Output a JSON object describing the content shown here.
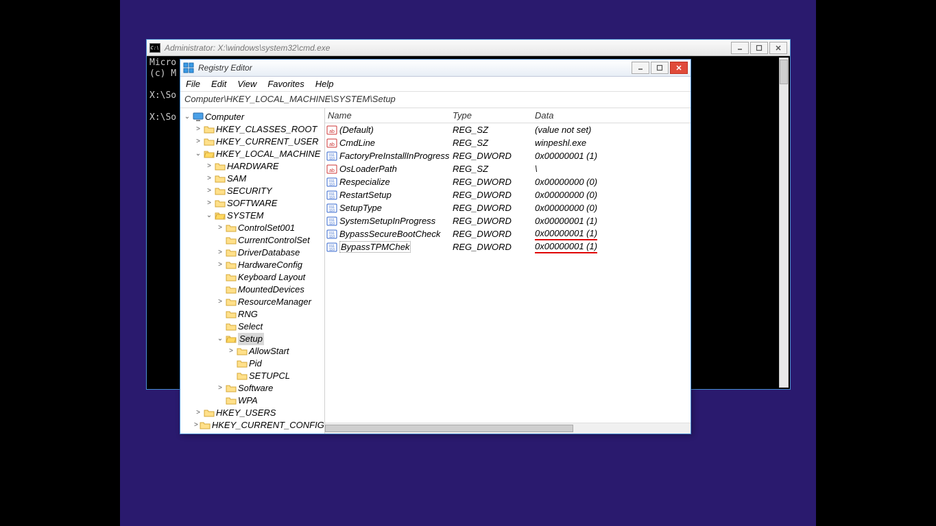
{
  "cmd": {
    "title": "Administrator: X:\\windows\\system32\\cmd.exe",
    "lines": [
      "Micro",
      "(c) M",
      "",
      "X:\\So",
      "",
      "X:\\So"
    ]
  },
  "reg": {
    "title": "Registry Editor",
    "menu": [
      "File",
      "Edit",
      "View",
      "Favorites",
      "Help"
    ],
    "address": "Computer\\HKEY_LOCAL_MACHINE\\SYSTEM\\Setup",
    "cols": {
      "name": "Name",
      "type": "Type",
      "data": "Data"
    },
    "tree": {
      "root": "Computer",
      "hkeys": {
        "classes": "HKEY_CLASSES_ROOT",
        "cuser": "HKEY_CURRENT_USER",
        "lm": "HKEY_LOCAL_MACHINE",
        "users": "HKEY_USERS",
        "cconf": "HKEY_CURRENT_CONFIG"
      },
      "lm_children": [
        "HARDWARE",
        "SAM",
        "SECURITY",
        "SOFTWARE",
        "SYSTEM"
      ],
      "system_children": [
        "ControlSet001",
        "CurrentControlSet",
        "DriverDatabase",
        "HardwareConfig",
        "Keyboard Layout",
        "MountedDevices",
        "ResourceManager",
        "RNG",
        "Select",
        "Setup",
        "Software",
        "WPA"
      ],
      "setup_children": [
        "AllowStart",
        "Pid",
        "SETUPCL"
      ]
    },
    "values": [
      {
        "icon": "sz",
        "name": "(Default)",
        "type": "REG_SZ",
        "data": "(value not set)",
        "u": false
      },
      {
        "icon": "sz",
        "name": "CmdLine",
        "type": "REG_SZ",
        "data": "winpeshl.exe",
        "u": false
      },
      {
        "icon": "dw",
        "name": "FactoryPreInstallInProgress",
        "type": "REG_DWORD",
        "data": "0x00000001 (1)",
        "u": false
      },
      {
        "icon": "sz",
        "name": "OsLoaderPath",
        "type": "REG_SZ",
        "data": "\\",
        "u": false
      },
      {
        "icon": "dw",
        "name": "Respecialize",
        "type": "REG_DWORD",
        "data": "0x00000000 (0)",
        "u": false
      },
      {
        "icon": "dw",
        "name": "RestartSetup",
        "type": "REG_DWORD",
        "data": "0x00000000 (0)",
        "u": false
      },
      {
        "icon": "dw",
        "name": "SetupType",
        "type": "REG_DWORD",
        "data": "0x00000000 (0)",
        "u": false
      },
      {
        "icon": "dw",
        "name": "SystemSetupInProgress",
        "type": "REG_DWORD",
        "data": "0x00000001 (1)",
        "u": false
      },
      {
        "icon": "dw",
        "name": "BypassSecureBootCheck",
        "type": "REG_DWORD",
        "data": "0x00000001 (1)",
        "u": true
      },
      {
        "icon": "dw",
        "name": "BypassTPMChek",
        "type": "REG_DWORD",
        "data": "0x00000001 (1)",
        "u": true,
        "sel": true
      }
    ]
  }
}
